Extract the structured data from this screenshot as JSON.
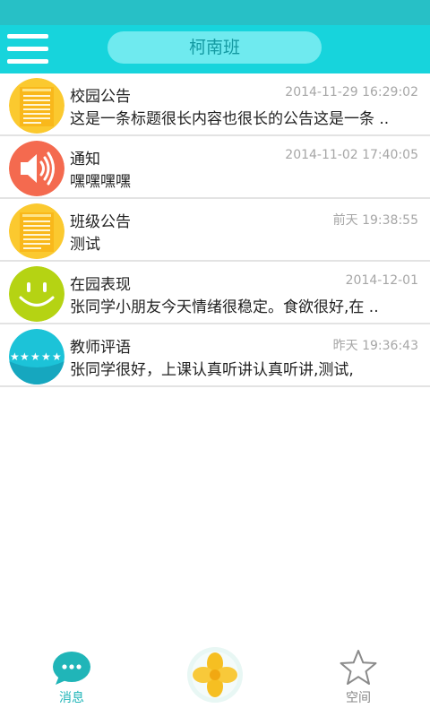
{
  "header": {
    "title": "柯南班"
  },
  "messages": [
    {
      "title": "校园公告",
      "time": "2014-11-29 16:29:02",
      "preview": "这是一条标题很长内容也很长的公告这是一条 ..",
      "icon": "notice-board-icon",
      "color": "#fbc92f"
    },
    {
      "title": "通知",
      "time": "2014-11-02 17:40:05",
      "preview": "嘿嘿嘿嘿",
      "icon": "speaker-icon",
      "color": "#f46a4f"
    },
    {
      "title": "班级公告",
      "time": "前天 19:38:55",
      "preview": "测试",
      "icon": "notice-board-icon",
      "color": "#fbc92f"
    },
    {
      "title": "在园表现",
      "time": "2014-12-01",
      "preview": "张同学小朋友今天情绪很稳定。食欲很好,在 ..",
      "icon": "smiley-icon",
      "color": "#b5d313"
    },
    {
      "title": "教师评语",
      "time": "昨天 19:36:43",
      "preview": "张同学很好，上课认真听讲认真听讲,测试,",
      "icon": "stars-icon",
      "color": "#1cc3d8"
    }
  ],
  "tabs": {
    "messages": {
      "label": "消息",
      "color": "#20b5b8"
    },
    "space": {
      "label": "空间",
      "color": "#888888"
    }
  }
}
